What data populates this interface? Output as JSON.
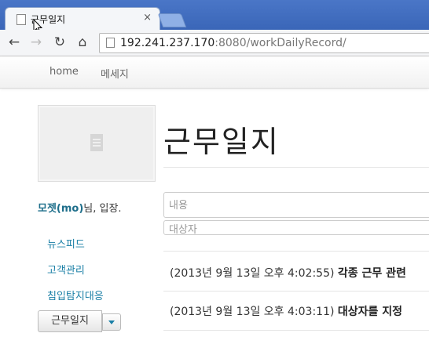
{
  "browser": {
    "tab_title": "근무일지",
    "url_host": "192.241.237.170",
    "url_rest": ":8080/workDailyRecord/"
  },
  "navbar": {
    "home": "home",
    "message": "메세지"
  },
  "page": {
    "title": "근무일지"
  },
  "user": {
    "name": "모젯(mo)",
    "suffix": "님, 입장."
  },
  "form": {
    "content_placeholder": "내용",
    "target_placeholder": "대상자"
  },
  "sidebar": {
    "items": [
      "뉴스피드",
      "고객관리",
      "침입탐지대응"
    ],
    "dropdown_label": "근무일지"
  },
  "entries": [
    {
      "time": "(2013년 9월 13일 오후 4:02:55)",
      "text": "각종 근무 관련"
    },
    {
      "time": "(2013년 9월 13일 오후 4:03:11)",
      "text": "대상자를 지정"
    }
  ]
}
